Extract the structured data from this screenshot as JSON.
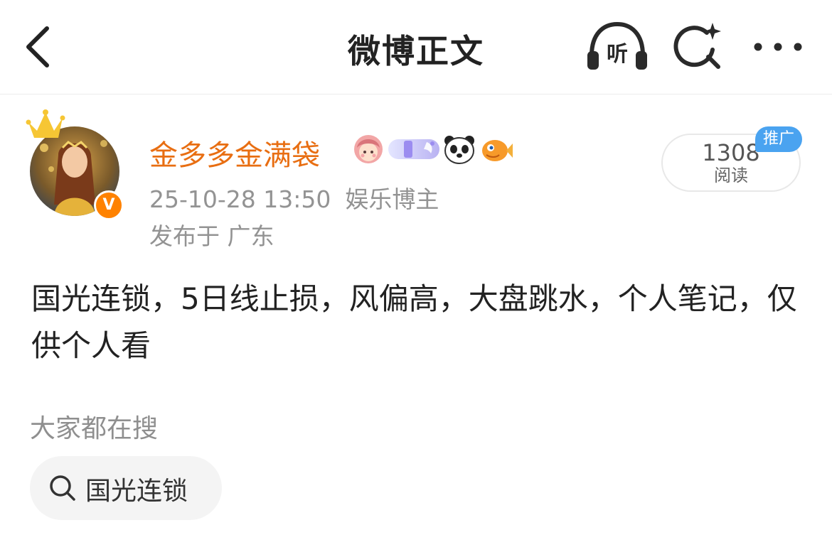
{
  "nav": {
    "title": "微博正文",
    "listen_label": "听",
    "back_icon": "chevron-left-icon",
    "search_icon": "sparkle-search-icon",
    "more_icon": "ellipsis-icon"
  },
  "author": {
    "name": "金多多金满袋",
    "verified_mark": "V",
    "badges": [
      "girl-avatar-badge",
      "fan-level-badge",
      "panda-badge",
      "fish-badge"
    ],
    "timestamp": "25-10-28 13:50",
    "tag": "娱乐博主",
    "location": "发布于 广东"
  },
  "reads": {
    "count": "1308",
    "label": "阅读",
    "promo_label": "推广"
  },
  "post": {
    "text": "国光连锁，5日线止损，风偏高，大盘跳水，个人笔记，仅供个人看"
  },
  "trending": {
    "title": "大家都在搜",
    "items": [
      {
        "label": "国光连锁"
      }
    ]
  },
  "colors": {
    "username": "#e86e12",
    "meta": "#939393",
    "promo": "#4aa3f0",
    "verified": "#ff8200"
  }
}
